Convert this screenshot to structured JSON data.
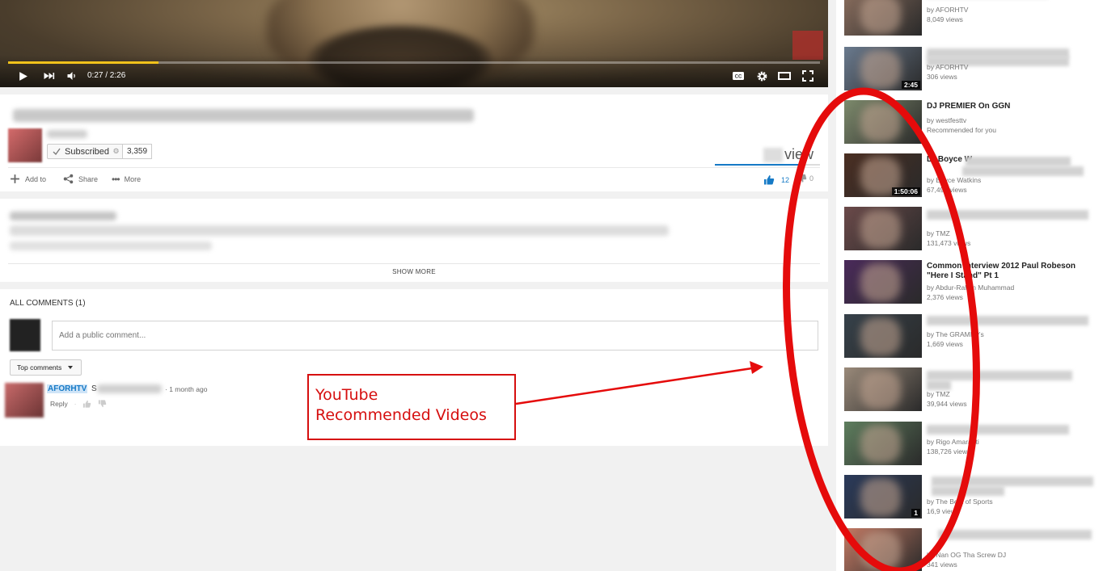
{
  "player": {
    "time": "0:27 / 2:26",
    "progress_fraction": 0.185,
    "icons": [
      "play-icon",
      "next-icon",
      "volume-icon",
      "captions-icon",
      "settings-icon",
      "theater-icon",
      "fullscreen-icon"
    ]
  },
  "channel": {
    "subscribe_label": "Subscribed",
    "subscriber_count": "3,359"
  },
  "stats": {
    "views_suffix": "view",
    "likes": "12",
    "dislikes": "0",
    "sentiment_fraction": 0.85
  },
  "actions": {
    "add_to": "Add to",
    "share": "Share",
    "more": "More"
  },
  "description": {
    "show_more": "SHOW MORE"
  },
  "comments": {
    "header": "ALL COMMENTS (1)",
    "placeholder": "Add a public comment...",
    "sort_label": "Top comments",
    "items": [
      {
        "author": "AFORHTV",
        "text_prefix": "S",
        "time": "· 1 month ago",
        "reply": "Reply"
      }
    ]
  },
  "annotation": {
    "line1": "YouTube",
    "line2": "Recommended Videos",
    "color": "#d60f0f"
  },
  "sidebar": {
    "items": [
      {
        "title": "",
        "channel": "by AFORHTV",
        "views": "8,049 views",
        "duration": "",
        "thumb": "#8a6e5e"
      },
      {
        "title": "",
        "channel": "by AFORHTV",
        "views": "306 views",
        "duration": "2:45",
        "thumb": "#6a7a8e"
      },
      {
        "title": "DJ PREMIER On GGN",
        "channel": "by westfesttv",
        "views": "Recommended for you",
        "duration": "",
        "thumb": "#7d8a6c"
      },
      {
        "title": "Dr Boyce W",
        "channel": "by Boyce Watkins",
        "views": "67,496 views",
        "duration": "1:50:06",
        "thumb": "#4a2e22"
      },
      {
        "title": "",
        "channel": "by TMZ",
        "views": "131,473 views",
        "duration": "",
        "thumb": "#6b4a4a"
      },
      {
        "title": "Common interview 2012 Paul Robeson \"Here I Stand\" Pt 1",
        "channel": "by Abdur-Rahim Muhammad",
        "views": "2,376 views",
        "duration": "",
        "thumb": "#4a2a5a"
      },
      {
        "title": "",
        "channel": "by The GRAMMYs",
        "views": "1,669 views",
        "duration": "",
        "thumb": "#36414a"
      },
      {
        "title": "",
        "channel": "by TMZ",
        "views": "39,944 views",
        "duration": "",
        "thumb": "#9a8a7a"
      },
      {
        "title": "",
        "channel": "by Rigo Amaranti",
        "views": "138,726 views",
        "duration": "",
        "thumb": "#5e7e5e"
      },
      {
        "title": "",
        "channel": "by The Best of Sports",
        "views": "16,9 views",
        "duration": "1",
        "thumb": "#2a3a5a"
      },
      {
        "title": "",
        "channel": "by Nan OG Tha Screw DJ",
        "views": "341 views",
        "duration": "",
        "thumb": "#c47a64"
      }
    ]
  }
}
